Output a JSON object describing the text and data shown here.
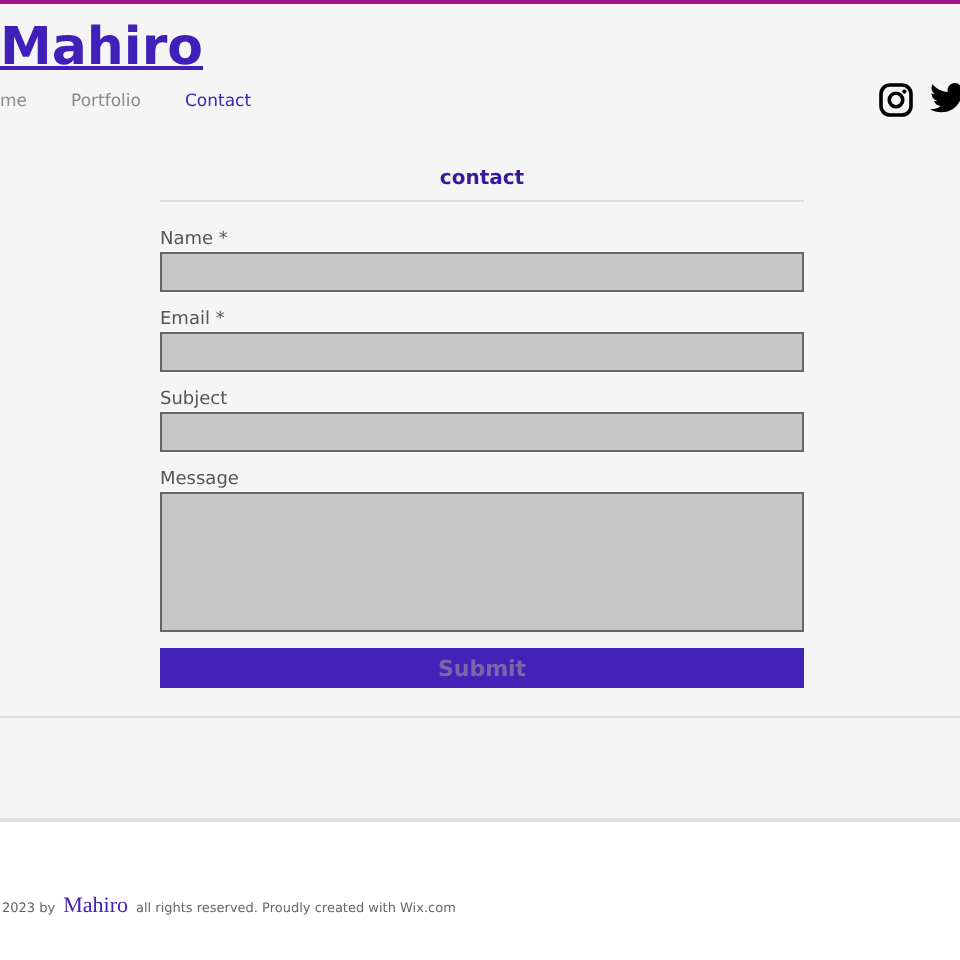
{
  "header": {
    "logo": "Mahiro",
    "nav": [
      {
        "label": "me",
        "selected": false
      },
      {
        "label": "Portfolio",
        "selected": false
      },
      {
        "label": "Contact",
        "selected": true
      }
    ]
  },
  "form": {
    "title": "contact",
    "fields": [
      {
        "label": "Name *",
        "kind": "input"
      },
      {
        "label": "Email *",
        "kind": "input"
      },
      {
        "label": "Subject",
        "kind": "input"
      },
      {
        "label": "Message",
        "kind": "textarea"
      }
    ],
    "submit": "Submit"
  },
  "footer": {
    "prefix": "2023 by",
    "brand": "Mahiro",
    "suffix": "all rights reserved.  Proudly created with Wix.com"
  }
}
